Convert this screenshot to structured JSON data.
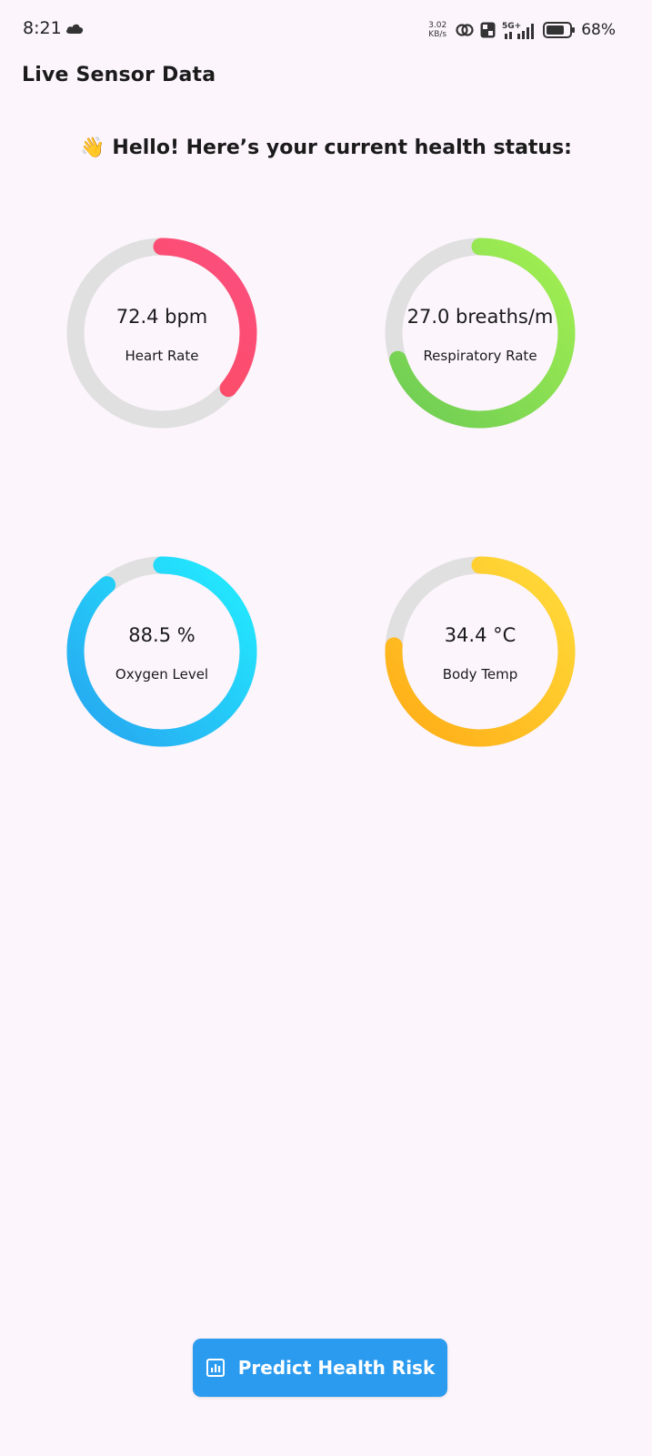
{
  "status_bar": {
    "time": "8:21",
    "net_speed_value": "3.02",
    "net_speed_unit": "KB/s",
    "signal_label": "5G+",
    "battery_pct": "68%",
    "icons": [
      "cloud-icon",
      "hotspot-icon",
      "volte-icon",
      "signal-icon",
      "battery-icon"
    ]
  },
  "app_bar": {
    "title": "Live Sensor Data"
  },
  "greeting": {
    "emoji": "👋",
    "text": "Hello! Here’s your current health status:"
  },
  "gauges": [
    {
      "id": "heart",
      "value": "72.4 bpm",
      "label": "Heart Rate",
      "fraction": 0.36,
      "color_start": "#fd4a55",
      "color_end": "#fb4f7f"
    },
    {
      "id": "resp",
      "value": "27.0 breaths/m",
      "label": "Respiratory Rate",
      "fraction": 0.7,
      "color_start": "#6dcc54",
      "color_end": "#a4f051"
    },
    {
      "id": "oxy",
      "value": "88.5 %",
      "label": "Oxygen Level",
      "fraction": 0.89,
      "color_start": "#27a4f0",
      "color_end": "#22eeff"
    },
    {
      "id": "temp",
      "value": "34.4 °C",
      "label": "Body Temp",
      "fraction": 0.76,
      "color_start": "#ffac16",
      "color_end": "#ffdc3a"
    }
  ],
  "track_color": "#e0e0e0",
  "predict_button": {
    "label": "Predict Health Risk",
    "icon": "chart-icon",
    "color": "#2b9bf0"
  }
}
